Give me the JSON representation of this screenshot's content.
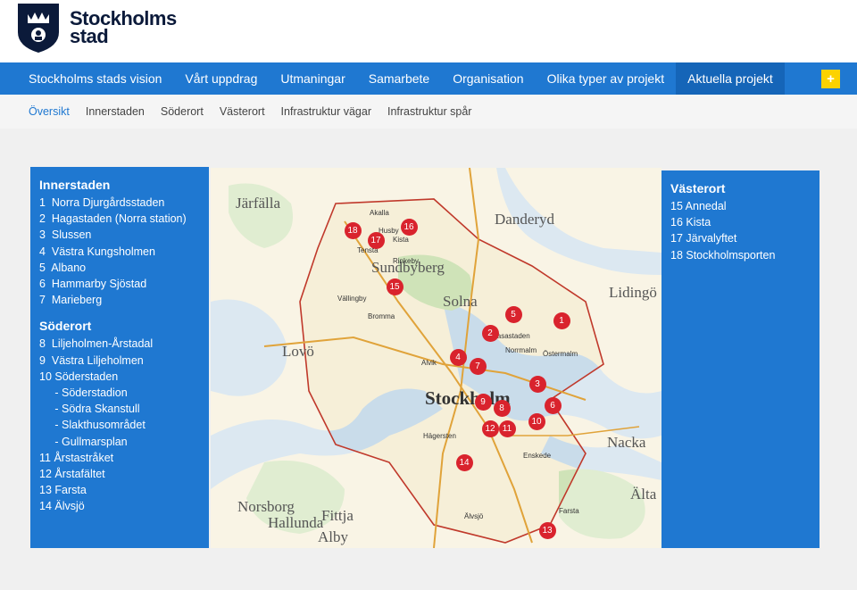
{
  "header": {
    "logo_line1": "Stockholms",
    "logo_line2": "stad"
  },
  "main_nav": [
    {
      "label": "Stockholms stads vision"
    },
    {
      "label": "Vårt uppdrag"
    },
    {
      "label": "Utmaningar"
    },
    {
      "label": "Samarbete"
    },
    {
      "label": "Organisation"
    },
    {
      "label": "Olika typer av projekt"
    },
    {
      "label": "Aktuella projekt",
      "active": true
    }
  ],
  "plus_label": "+",
  "sub_nav": [
    {
      "label": "Översikt",
      "active": true
    },
    {
      "label": "Innerstaden"
    },
    {
      "label": "Söderort"
    },
    {
      "label": "Västerort"
    },
    {
      "label": "Infrastruktur vägar"
    },
    {
      "label": "Infrastruktur spår"
    }
  ],
  "left_panel": {
    "region1_title": "Innerstaden",
    "region1_items": [
      "1  Norra Djurgårdsstaden",
      "2  Hagastaden (Norra station)",
      "3  Slussen",
      "4  Västra Kungsholmen",
      "5  Albano",
      "6  Hammarby Sjöstad",
      "7  Marieberg"
    ],
    "region2_title": "Söderort",
    "region2_items": [
      "8  Liljeholmen-Årstadal",
      "9  Västra Liljeholmen",
      "10 Söderstaden",
      "     - Söderstadion",
      "     - Södra Skanstull",
      "     - Slakthusområdet",
      "     - Gullmarsplan",
      "11 Årstastråket",
      "12 Årstafältet",
      "13 Farsta",
      "14 Älvsjö"
    ]
  },
  "right_panel": {
    "title": "Västerort",
    "items": [
      "15 Annedal",
      "16 Kista",
      "17 Järvalyftet",
      "18 Stockholmsporten"
    ]
  },
  "map": {
    "colors": {
      "land": "#f6efd8",
      "water": "#c9dcea",
      "green": "#cfe3b8",
      "boundary": "#c0392b",
      "marker": "#d9232d"
    },
    "labels": [
      {
        "text": "Järfälla",
        "cls": "big"
      },
      {
        "text": "Danderyd",
        "cls": "big"
      },
      {
        "text": "Sundbyberg",
        "cls": "big"
      },
      {
        "text": "Solna",
        "cls": "big"
      },
      {
        "text": "Lidingö",
        "cls": "big"
      },
      {
        "text": "Lovö",
        "cls": "big"
      },
      {
        "text": "Stockholm",
        "cls": "huge"
      },
      {
        "text": "Nacka",
        "cls": "big"
      },
      {
        "text": "Akalla",
        "cls": ""
      },
      {
        "text": "Husby",
        "cls": ""
      },
      {
        "text": "Kista",
        "cls": ""
      },
      {
        "text": "Tensta",
        "cls": ""
      },
      {
        "text": "Rinkeby",
        "cls": ""
      },
      {
        "text": "Vällingby",
        "cls": ""
      },
      {
        "text": "Bromma",
        "cls": ""
      },
      {
        "text": "Alvik",
        "cls": ""
      },
      {
        "text": "Hägersten",
        "cls": ""
      },
      {
        "text": "Farsta",
        "cls": ""
      },
      {
        "text": "Älvsjö",
        "cls": ""
      },
      {
        "text": "Enskede",
        "cls": ""
      },
      {
        "text": "Östermalm",
        "cls": ""
      },
      {
        "text": "Norrmalm",
        "cls": ""
      },
      {
        "text": "Vasastaden",
        "cls": ""
      },
      {
        "text": "Hallunda",
        "cls": "big"
      },
      {
        "text": "Norsborg",
        "cls": "big"
      },
      {
        "text": "Fittja",
        "cls": "big"
      },
      {
        "text": "Alby",
        "cls": "big"
      },
      {
        "text": "Älta",
        "cls": "big"
      }
    ],
    "markers": [
      "18",
      "17",
      "16",
      "15",
      "5",
      "1",
      "2",
      "4",
      "7",
      "3",
      "9",
      "8",
      "6",
      "10",
      "12",
      "11",
      "14",
      "13"
    ]
  }
}
